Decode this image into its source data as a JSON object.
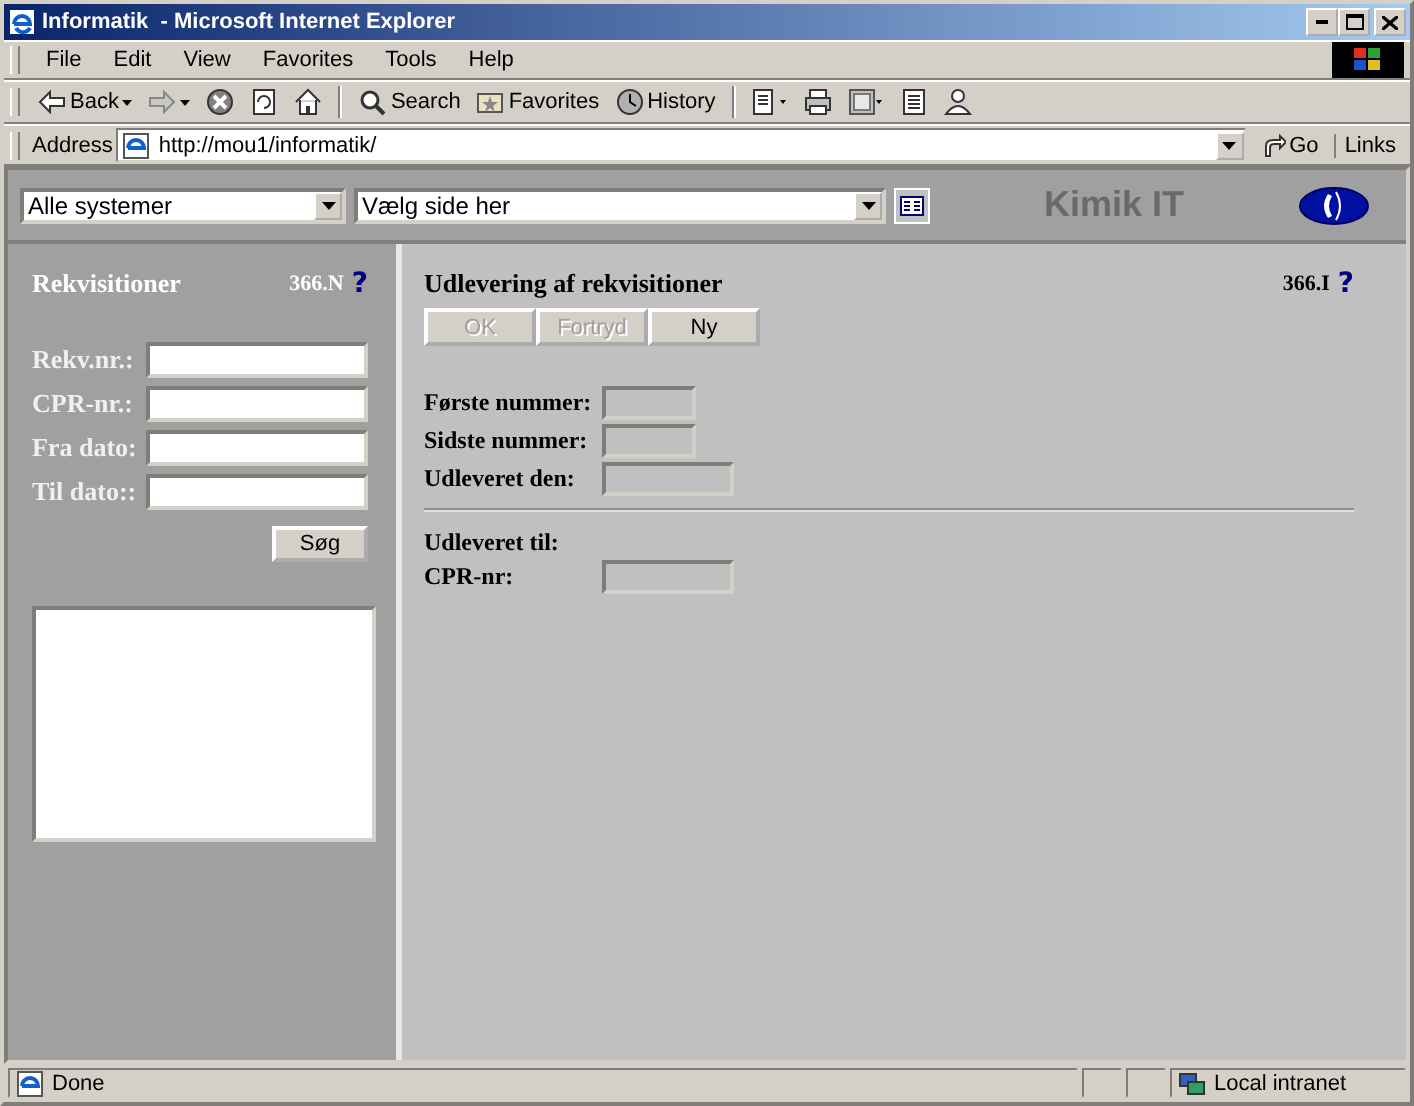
{
  "window": {
    "title": "Informatik  - Microsoft Internet Explorer"
  },
  "menu": [
    "File",
    "Edit",
    "View",
    "Favorites",
    "Tools",
    "Help"
  ],
  "toolbar": [
    {
      "kind": "back",
      "label": "Back"
    },
    {
      "kind": "forward"
    },
    {
      "kind": "stop"
    },
    {
      "kind": "refresh"
    },
    {
      "kind": "home"
    },
    {
      "kind": "search",
      "label": "Search"
    },
    {
      "kind": "favorites",
      "label": "Favorites"
    },
    {
      "kind": "history",
      "label": "History"
    },
    {
      "kind": "edit"
    },
    {
      "kind": "print"
    },
    {
      "kind": "discuss"
    },
    {
      "kind": "notes"
    },
    {
      "kind": "messenger"
    }
  ],
  "address": {
    "label": "Address",
    "value": "http://mou1/informatik/",
    "go": "Go",
    "links": "Links"
  },
  "page_header": {
    "system_select": "Alle systemer",
    "page_select": "Vælg side her",
    "brand": "Kimik IT"
  },
  "search_panel": {
    "title": "Rekvisitioner",
    "code": "366.N",
    "help": "?",
    "fields": [
      {
        "label": "Rekv.nr.:"
      },
      {
        "label": "CPR-nr.:"
      },
      {
        "label": "Fra dato:"
      },
      {
        "label": "Til dato::"
      }
    ],
    "button": "Søg"
  },
  "main": {
    "title": "Udlevering af rekvisitioner",
    "code": "366.I",
    "help": "?",
    "buttons": [
      {
        "label": "OK",
        "disabled": true
      },
      {
        "label": "Fortryd",
        "disabled": true
      },
      {
        "label": "Ny",
        "disabled": false
      }
    ],
    "fields": [
      {
        "label": "Første nummer:",
        "kind": "short",
        "disabled": true
      },
      {
        "label": "Sidste nummer:",
        "kind": "short",
        "disabled": true
      },
      {
        "label": "Udleveret den:",
        "kind": "long",
        "disabled": true
      }
    ],
    "section": "Udleveret til:",
    "section_fields": [
      {
        "label": "CPR-nr:",
        "kind": "long",
        "disabled": true
      }
    ]
  },
  "status_bar": {
    "text": "Done",
    "zone": "Local intranet"
  }
}
